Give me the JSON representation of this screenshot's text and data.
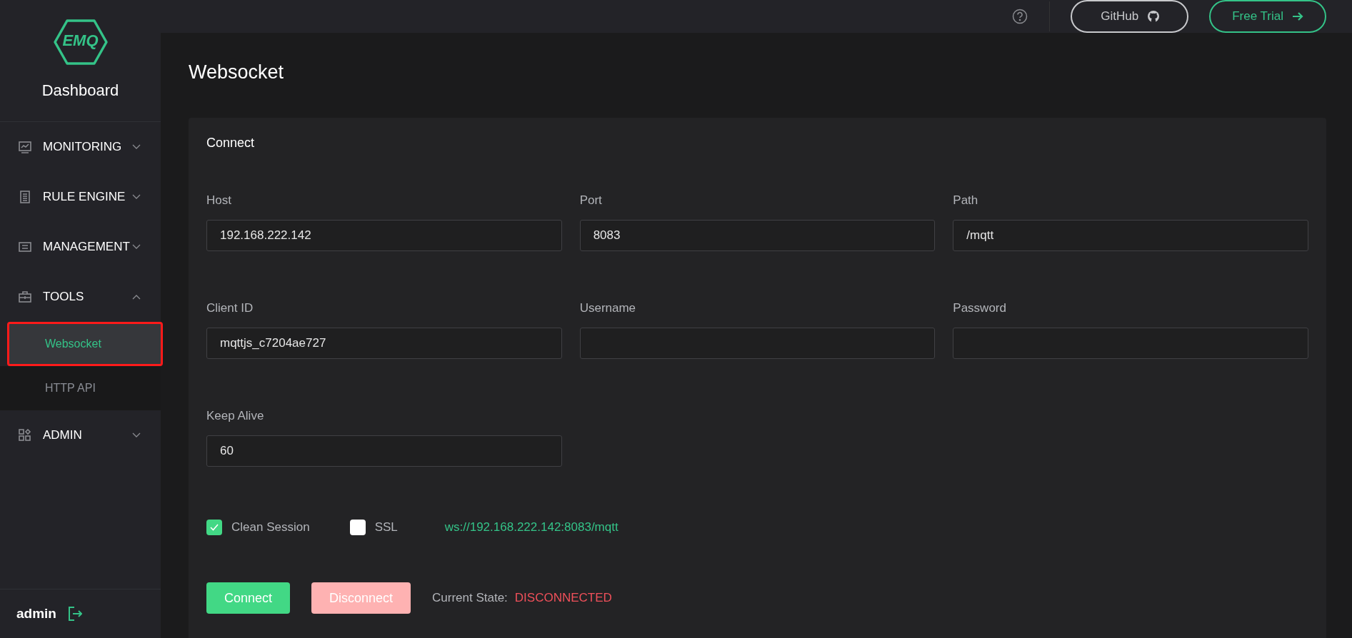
{
  "sidebar": {
    "logo": "EMQ",
    "title": "Dashboard",
    "menu": [
      {
        "label": "MONITORING",
        "expanded": false
      },
      {
        "label": "RULE ENGINE",
        "expanded": false
      },
      {
        "label": "MANAGEMENT",
        "expanded": false
      },
      {
        "label": "TOOLS",
        "expanded": true,
        "children": [
          {
            "label": "Websocket",
            "selected": true,
            "highlighted": true
          },
          {
            "label": "HTTP API",
            "selected": false,
            "highlighted": false
          }
        ]
      },
      {
        "label": "ADMIN",
        "expanded": false
      }
    ],
    "user": "admin"
  },
  "header": {
    "github": "GitHub",
    "free_trial": "Free Trial"
  },
  "page_title": "Websocket",
  "card": {
    "title": "Connect",
    "fields": [
      {
        "label": "Host",
        "value": "192.168.222.142"
      },
      {
        "label": "Port",
        "value": "8083"
      },
      {
        "label": "Path",
        "value": "/mqtt"
      },
      {
        "label": "Client ID",
        "value": "mqttjs_c7204ae727"
      },
      {
        "label": "Username"
      },
      {
        "label": "Password"
      },
      {
        "label": "Keep Alive",
        "value": "60"
      }
    ],
    "checkboxes": [
      {
        "label": "Clean Session",
        "checked": true
      },
      {
        "label": "SSL",
        "checked": false
      }
    ],
    "url": "ws://192.168.222.142:8083/mqtt",
    "buttons": [
      {
        "label": "Connect",
        "kind": "primary",
        "disabled": false
      },
      {
        "label": "Disconnect",
        "kind": "danger",
        "disabled": true
      }
    ],
    "state_label": "Current State:",
    "state": "DISCONNECTED"
  }
}
